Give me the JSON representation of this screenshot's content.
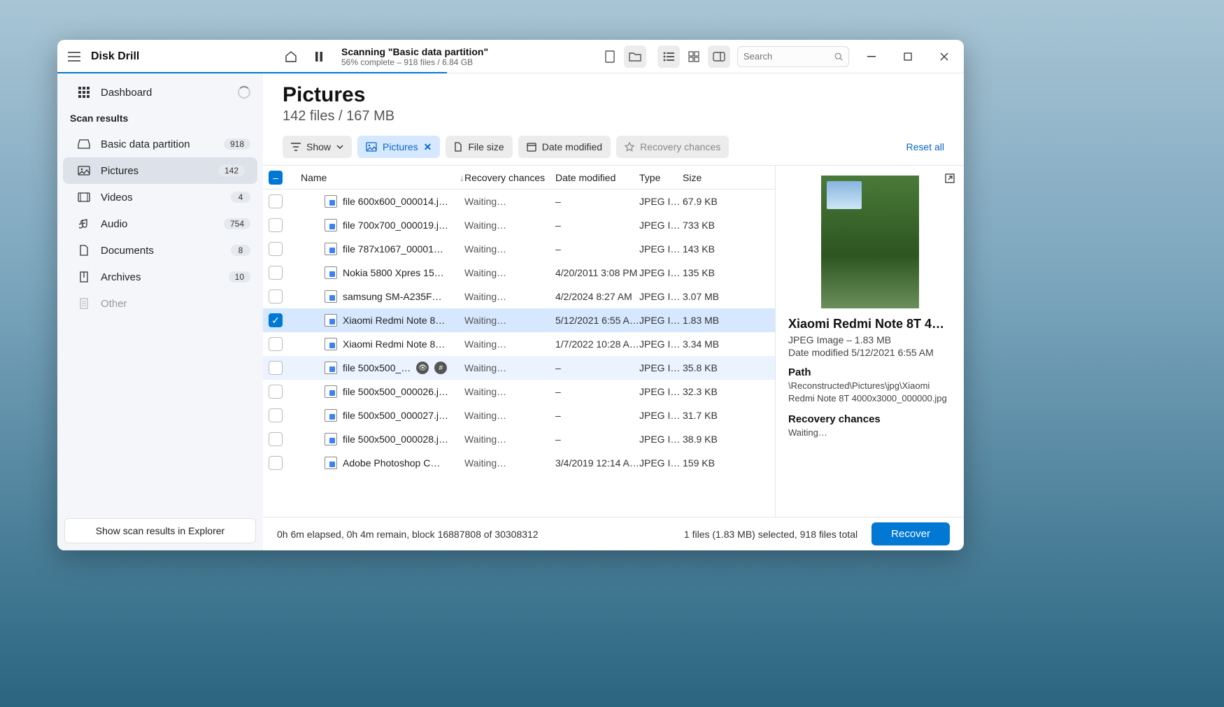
{
  "app_title": "Disk Drill",
  "scan": {
    "title": "Scanning \"Basic data partition\"",
    "progress_pct": 56,
    "subtitle": "56% complete – 918 files / 6.84 GB"
  },
  "search_placeholder": "Search",
  "sidebar": {
    "dashboard": "Dashboard",
    "scan_results_heading": "Scan results",
    "items": [
      {
        "icon": "drive",
        "label": "Basic data partition",
        "count": "918"
      },
      {
        "icon": "image",
        "label": "Pictures",
        "count": "142",
        "selected": true
      },
      {
        "icon": "video",
        "label": "Videos",
        "count": "4"
      },
      {
        "icon": "audio",
        "label": "Audio",
        "count": "754"
      },
      {
        "icon": "doc",
        "label": "Documents",
        "count": "8"
      },
      {
        "icon": "archive",
        "label": "Archives",
        "count": "10"
      },
      {
        "icon": "other",
        "label": "Other",
        "count": ""
      }
    ],
    "explorer_button": "Show scan results in Explorer"
  },
  "main": {
    "title": "Pictures",
    "subtitle": "142 files / 167 MB",
    "filters": {
      "show": "Show",
      "pictures": "Pictures",
      "file_size": "File size",
      "date_modified": "Date modified",
      "recovery_chances": "Recovery chances",
      "reset": "Reset all"
    },
    "columns": {
      "name": "Name",
      "recovery": "Recovery chances",
      "date": "Date modified",
      "type": "Type",
      "size": "Size"
    },
    "rows": [
      {
        "name": "file 600x600_000014.j…",
        "recov": "Waiting…",
        "date": "–",
        "type": "JPEG I…",
        "size": "67.9 KB"
      },
      {
        "name": "file 700x700_000019.j…",
        "recov": "Waiting…",
        "date": "–",
        "type": "JPEG I…",
        "size": "733 KB"
      },
      {
        "name": "file 787x1067_00001…",
        "recov": "Waiting…",
        "date": "–",
        "type": "JPEG I…",
        "size": "143 KB"
      },
      {
        "name": "Nokia 5800 Xpres 15…",
        "recov": "Waiting…",
        "date": "4/20/2011 3:08 PM",
        "type": "JPEG I…",
        "size": "135 KB"
      },
      {
        "name": "samsung SM-A235F…",
        "recov": "Waiting…",
        "date": "4/2/2024 8:27 AM",
        "type": "JPEG I…",
        "size": "3.07 MB"
      },
      {
        "name": "Xiaomi Redmi Note 8…",
        "recov": "Waiting…",
        "date": "5/12/2021 6:55 A…",
        "type": "JPEG I…",
        "size": "1.83 MB",
        "selected": true
      },
      {
        "name": "Xiaomi Redmi Note 8…",
        "recov": "Waiting…",
        "date": "1/7/2022 10:28 A…",
        "type": "JPEG I…",
        "size": "3.34 MB"
      },
      {
        "name": "file 500x500_…",
        "recov": "Waiting…",
        "date": "–",
        "type": "JPEG I…",
        "size": "35.8 KB",
        "hovered": true,
        "badges": true
      },
      {
        "name": "file 500x500_000026.j…",
        "recov": "Waiting…",
        "date": "–",
        "type": "JPEG I…",
        "size": "32.3 KB"
      },
      {
        "name": "file 500x500_000027.j…",
        "recov": "Waiting…",
        "date": "–",
        "type": "JPEG I…",
        "size": "31.7 KB"
      },
      {
        "name": "file 500x500_000028.j…",
        "recov": "Waiting…",
        "date": "–",
        "type": "JPEG I…",
        "size": "38.9 KB"
      },
      {
        "name": "Adobe Photoshop C…",
        "recov": "Waiting…",
        "date": "3/4/2019 12:14 A…",
        "type": "JPEG I…",
        "size": "159 KB"
      }
    ]
  },
  "preview": {
    "title": "Xiaomi Redmi Note 8T 4…",
    "meta": "JPEG Image – 1.83 MB",
    "date": "Date modified 5/12/2021 6:55 AM",
    "path_heading": "Path",
    "path": "\\Reconstructed\\Pictures\\jpg\\Xiaomi Redmi Note 8T 4000x3000_000000.jpg",
    "recovery_heading": "Recovery chances",
    "recovery_value": "Waiting…"
  },
  "status": {
    "left": "0h 6m elapsed, 0h 4m remain, block 16887808 of 30308312",
    "right": "1 files (1.83 MB) selected, 918 files total",
    "recover": "Recover"
  }
}
